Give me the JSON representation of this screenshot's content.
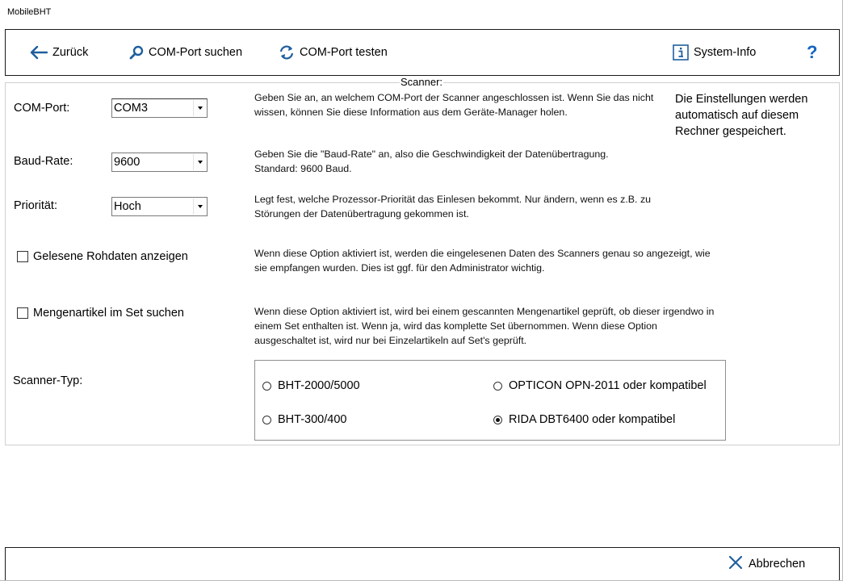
{
  "window": {
    "title": "MobileBHT"
  },
  "toolbar": {
    "back_label": "Zurück",
    "search_label": "COM-Port suchen",
    "test_label": "COM-Port testen",
    "sysinfo_label": "System-Info",
    "help_label": "?"
  },
  "group": {
    "title": "Scanner:"
  },
  "fields": {
    "com_port": {
      "label": "COM-Port:",
      "value": "COM3",
      "help": "Geben Sie an, an welchem COM-Port der Scanner angeschlossen ist. Wenn Sie das nicht wissen, können Sie diese Information aus dem Geräte-Manager holen."
    },
    "baud_rate": {
      "label": "Baud-Rate:",
      "value": "9600",
      "help_line1": "Geben Sie die \"Baud-Rate\" an, also die Geschwindigkeit der Datenübertragung.",
      "help_line2": "Standard: 9600 Baud."
    },
    "priority": {
      "label": "Priorität:",
      "value": "Hoch",
      "help": "Legt fest, welche Prozessor-Priorität das Einlesen bekommt. Nur ändern, wenn es z.B. zu Störungen der Datenübertragung gekommen ist."
    }
  },
  "side_note": "Die Einstellungen werden automatisch auf diesem Rechner gespeichert.",
  "options": {
    "raw_data": {
      "label": "Gelesene Rohdaten anzeigen",
      "checked": false,
      "help": "Wenn diese Option aktiviert ist, werden die eingelesenen Daten des Scanners genau so angezeigt, wie sie empfangen wurden.  Dies ist ggf. für den Administrator wichtig."
    },
    "set_search": {
      "label": "Mengenartikel im Set suchen",
      "checked": false,
      "help": "Wenn diese Option aktiviert ist, wird bei einem gescannten Mengenartikel geprüft, ob dieser irgendwo in einem Set enthalten ist. Wenn ja, wird das komplette Set übernommen. Wenn diese Option ausgeschaltet ist, wird nur bei Einzelartikeln auf Set's geprüft."
    }
  },
  "scanner_type": {
    "label": "Scanner-Typ:",
    "options": [
      {
        "label": "BHT-2000/5000",
        "selected": false
      },
      {
        "label": "OPTICON OPN-2011 oder kompatibel",
        "selected": false
      },
      {
        "label": "BHT-300/400",
        "selected": false
      },
      {
        "label": "RIDA DBT6400 oder kompatibel",
        "selected": true
      }
    ]
  },
  "footer": {
    "cancel_label": "Abbrechen"
  },
  "colors": {
    "icon_blue": "#1f5f9e",
    "help_blue": "#1565c0"
  }
}
